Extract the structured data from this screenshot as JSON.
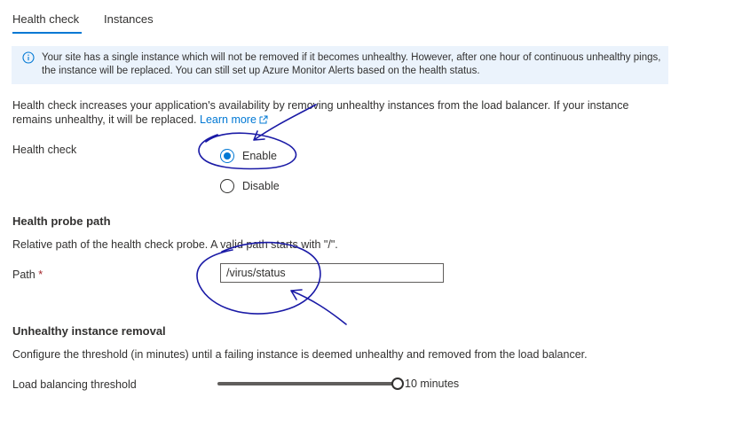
{
  "tabs": [
    {
      "label": "Health check",
      "active": true
    },
    {
      "label": "Instances",
      "active": false
    }
  ],
  "banner": {
    "icon": "info-icon",
    "text": "Your site has a single instance which will not be removed if it becomes unhealthy. However, after one hour of continuous unhealthy pings, the instance will be replaced. You can still set up Azure Monitor Alerts based on the health status."
  },
  "intro": {
    "text": "Health check increases your application's availability by removing unhealthy instances from the load balancer. If your instance remains unhealthy, it will be replaced.",
    "link": "Learn more"
  },
  "health_check": {
    "label": "Health check",
    "options": [
      {
        "label": "Enable",
        "selected": true
      },
      {
        "label": "Disable",
        "selected": false
      }
    ]
  },
  "probe": {
    "title": "Health probe path",
    "description": "Relative path of the health check probe. A valid path starts with \"/\".",
    "path_label": "Path",
    "required_mark": "*",
    "path_value": "/virus/status"
  },
  "removal": {
    "title": "Unhealthy instance removal",
    "description": "Configure the threshold (in minutes) until a failing instance is deemed unhealthy and removed from the load balancer.",
    "threshold_label": "Load balancing threshold",
    "threshold_value": "10 minutes",
    "threshold_fraction": 1.0
  },
  "colors": {
    "accent": "#0078d4",
    "banner_bg": "#ebf3fc",
    "annotation_ink": "#1a1aa6",
    "required": "#a4262c"
  }
}
